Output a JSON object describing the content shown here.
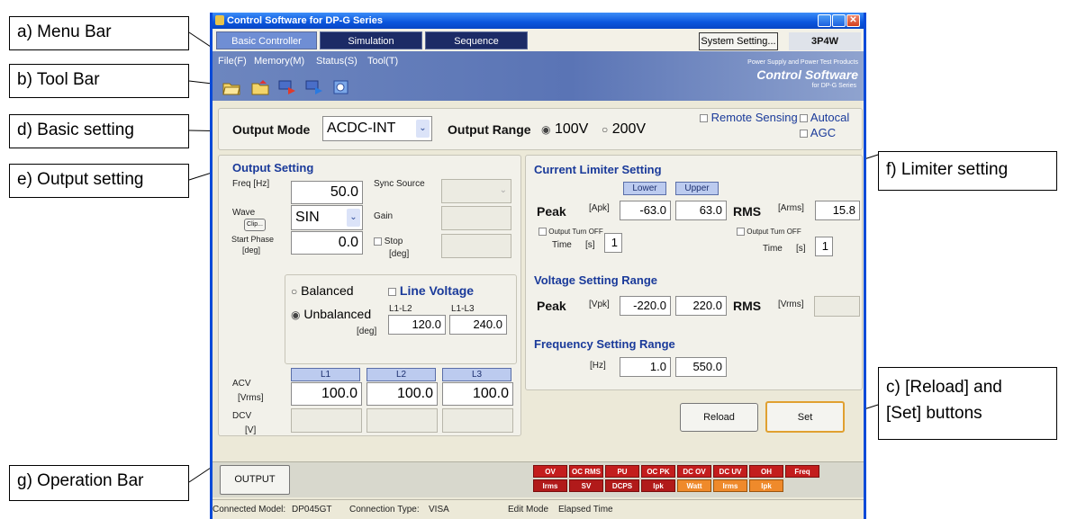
{
  "callouts": {
    "a": "a) Menu Bar",
    "b": "b) Tool Bar",
    "d": "d) Basic setting",
    "e": "e) Output setting",
    "f": "f) Limiter setting",
    "c1": "c) [Reload] and",
    "c2": "[Set] buttons",
    "g": "g) Operation Bar"
  },
  "window": {
    "title": "Control Software for DP-G Series"
  },
  "tabs": [
    "Basic Controller",
    "Simulation",
    "Sequence"
  ],
  "system_setting_label": "System Setting...",
  "phase_label": "3P4W",
  "menu": [
    "File(F)",
    "Memory(M)",
    "Status(S)",
    "Tool(T)"
  ],
  "brand": {
    "line1": "Power Supply and Power Test Products",
    "line2": "Control Software",
    "line3": "for DP-G Series"
  },
  "toolbar_icons": [
    "open-file-icon",
    "save-file-icon",
    "download-icon",
    "upload-icon",
    "settings-icon"
  ],
  "basic": {
    "output_mode_label": "Output Mode",
    "output_mode_value": "ACDC-INT",
    "output_range_label": "Output Range",
    "range_100": "100V",
    "range_200": "200V",
    "remote_sensing": "Remote Sensing",
    "autocal": "Autocal",
    "agc": "AGC"
  },
  "output": {
    "title": "Output Setting",
    "freq_label": "Freq [Hz]",
    "freq_value": "50.0",
    "sync_source_label": "Sync Source",
    "wave_label": "Wave",
    "clip_label": "Clip...",
    "wave_value": "SIN",
    "gain_label": "Gain",
    "start_phase_label1": "Start Phase",
    "start_phase_label2": "[deg]",
    "start_phase_value": "0.0",
    "stop_label": "Stop",
    "stop_unit": "[deg]",
    "balanced": "Balanced",
    "unbalanced": "Unbalanced",
    "line_voltage": "Line Voltage",
    "l1l2_label": "L1-L2",
    "l1l3_label": "L1-L3",
    "deg_label": "[deg]",
    "l1l2_value": "120.0",
    "l1l3_value": "240.0",
    "phase_headers": [
      "L1",
      "L2",
      "L3"
    ],
    "acv_label": "ACV",
    "acv_unit": "[Vrms]",
    "acv_values": [
      "100.0",
      "100.0",
      "100.0"
    ],
    "dcv_label": "DCV",
    "dcv_unit": "[V]"
  },
  "limiter": {
    "current_title": "Current Limiter Setting",
    "lower": "Lower",
    "upper": "Upper",
    "peak_label": "Peak",
    "apk_unit": "[Apk]",
    "peak_lower": "-63.0",
    "peak_upper": "63.0",
    "rms_label": "RMS",
    "arms_unit": "[Arms]",
    "rms_value": "15.8",
    "output_turn_off": "Output Turn OFF",
    "time_label": "Time",
    "sec_unit": "[s]",
    "time_value_1": "1",
    "time_value_2": "1",
    "voltage_title": "Voltage Setting Range",
    "vpk_unit": "[Vpk]",
    "v_lower": "-220.0",
    "v_upper": "220.0",
    "vrms_unit": "[Vrms]",
    "freq_title": "Frequency Setting Range",
    "hz_unit": "[Hz]",
    "f_lower": "1.0",
    "f_upper": "550.0"
  },
  "buttons": {
    "reload": "Reload",
    "set": "Set",
    "output": "OUTPUT"
  },
  "alarms_row1": [
    "OV",
    "OC RMS",
    "PU",
    "OC PK",
    "DC OV",
    "DC UV",
    "OH",
    "Freq"
  ],
  "alarms_row2": [
    "Irms",
    "SV",
    "DCPS",
    "Ipk",
    "Watt",
    "Irms",
    "Ipk"
  ],
  "status": {
    "model_label": "Connected Model:",
    "model_value": "DP045GT",
    "conn_label": "Connection Type:",
    "conn_value": "VISA",
    "edit_mode": "Edit Mode",
    "elapsed": "Elapsed Time"
  },
  "colors": {
    "tab_active": "#6f8ed4",
    "tab_dark": "#1c2b66",
    "alarm_red": "#c31d1d",
    "alarm_orange": "#ef8a2b",
    "title_blue": "#1a3a9a"
  }
}
